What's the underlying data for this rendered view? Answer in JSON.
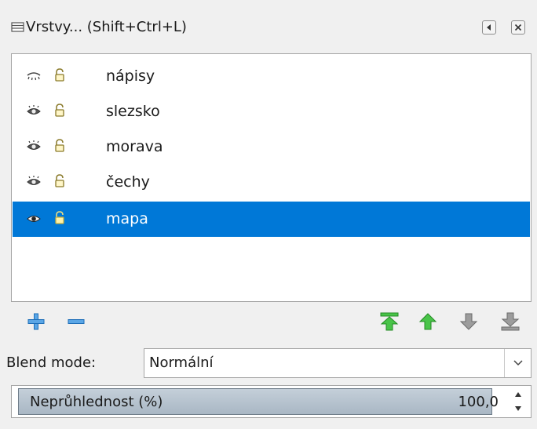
{
  "panel": {
    "title": "Vrstvy... (Shift+Ctrl+L)"
  },
  "layers": [
    {
      "name": "nápisy",
      "visible": false,
      "selected": false
    },
    {
      "name": "slezsko",
      "visible": true,
      "selected": false
    },
    {
      "name": "morava",
      "visible": true,
      "selected": false
    },
    {
      "name": "čechy",
      "visible": true,
      "selected": false
    },
    {
      "name": "mapa",
      "visible": true,
      "selected": true
    }
  ],
  "blend": {
    "label": "Blend mode:",
    "value": "Normální"
  },
  "opacity": {
    "label": "Neprůhlednost (%)",
    "value": "100,0",
    "fraction": 1.0
  },
  "colors": {
    "selection": "#0078d7",
    "arrow_green": "#3cb53c",
    "add_remove_blue": "#1f7fd1"
  }
}
